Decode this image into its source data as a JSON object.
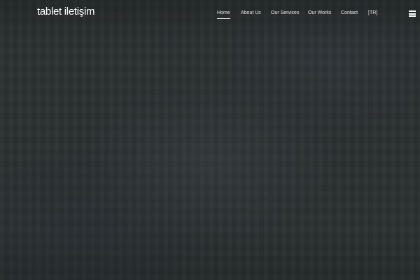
{
  "header": {
    "logo_text": "tablet iletişim",
    "nav": {
      "home": "Home",
      "about": "About Us",
      "services": "Our Services",
      "works": "Our Works",
      "contact": "Contact",
      "language": "[TR]"
    },
    "active_item": "Home",
    "menu_icon": "hamburger-menu-icon"
  },
  "colors": {
    "background": "#2b3132",
    "nav_text": "#e9ecec",
    "logo_text": "#ffffff"
  }
}
